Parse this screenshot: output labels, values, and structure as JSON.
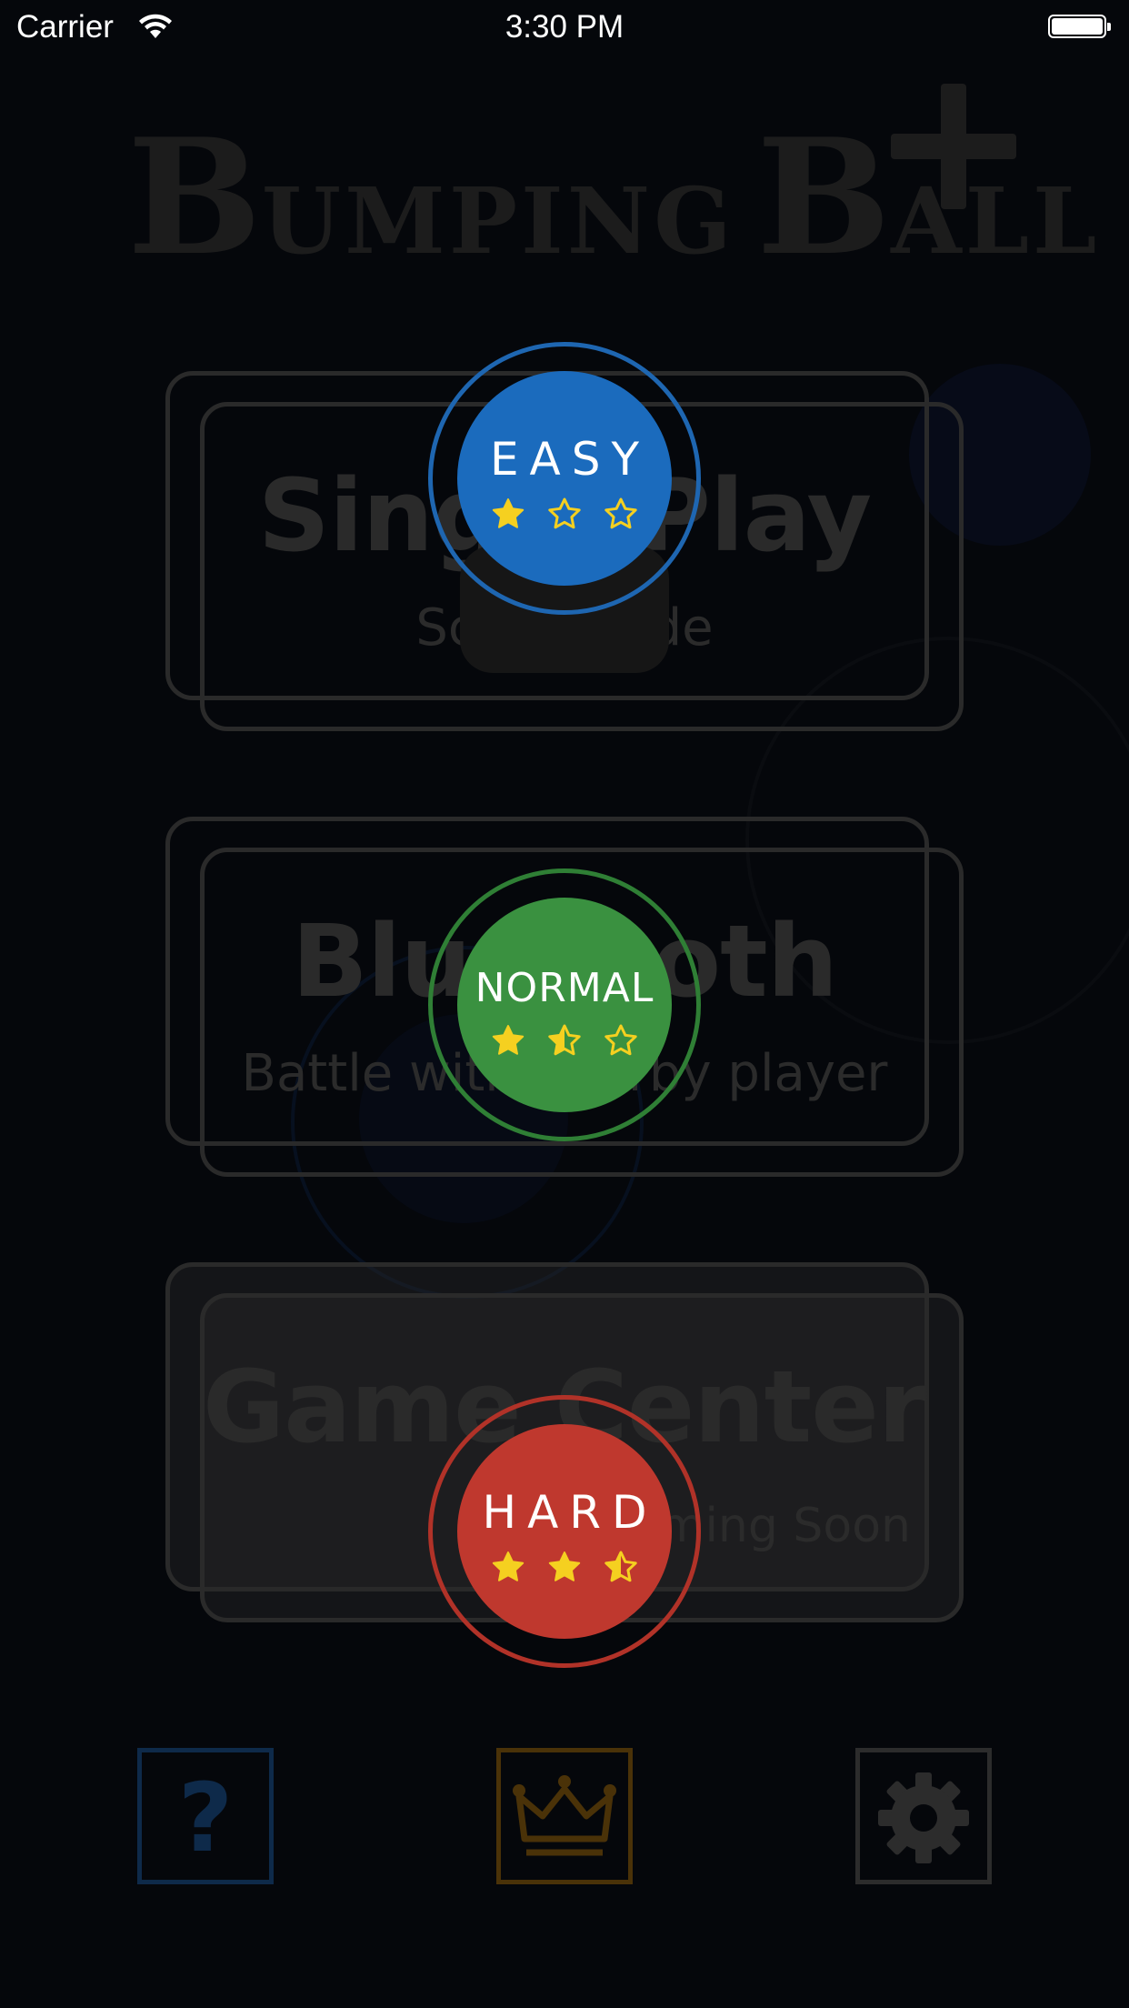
{
  "status_bar": {
    "carrier": "Carrier",
    "time": "3:30 PM"
  },
  "logo": {
    "initial_1": "B",
    "rest_1": "UMPING",
    "initial_2": "B",
    "rest_2": "ALL",
    "suffix_icon": "plus-icon"
  },
  "modes": [
    {
      "title": "Single Play",
      "subtitle": "Score Mode"
    },
    {
      "title": "Bluetooth",
      "subtitle": "Battle with nearby player"
    },
    {
      "title": "Game Center",
      "subtitle": "Coming Soon"
    }
  ],
  "difficulty": {
    "easy": {
      "label": "EASY",
      "stars": 1,
      "color": "#1b6bbd",
      "ring": "#1e66b1"
    },
    "normal": {
      "label": "NORMAL",
      "stars": 1.5,
      "color": "#3a9140",
      "ring": "#2f7f35"
    },
    "hard": {
      "label": "HARD",
      "stars": 2.5,
      "color": "#bf382e",
      "ring": "#b13228"
    }
  },
  "star_color": "#f5d020",
  "bottom_buttons": [
    {
      "icon": "help-icon",
      "color": "#0e2a4a"
    },
    {
      "icon": "crown-icon",
      "color": "#4a3208"
    },
    {
      "icon": "settings-icon",
      "color": "#2c2c2c"
    }
  ]
}
